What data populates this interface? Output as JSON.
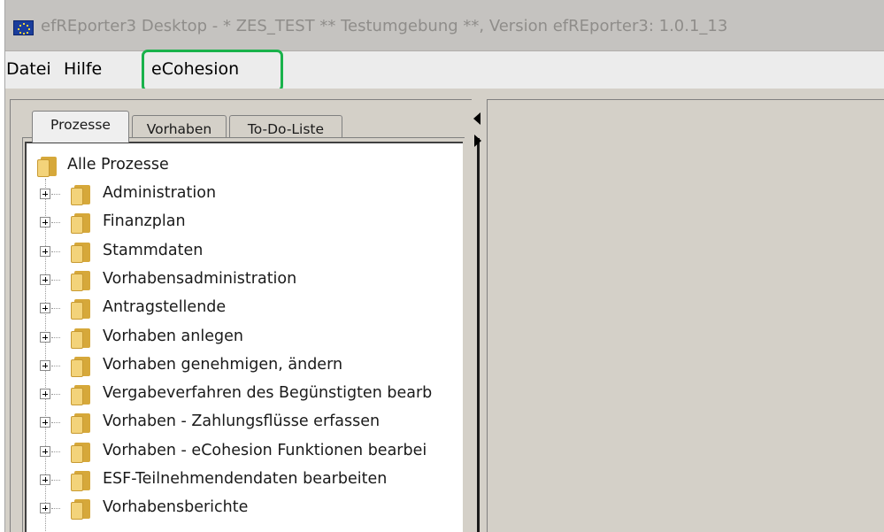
{
  "window": {
    "title": "efREporter3 Desktop - * ZES_TEST  ** Testumgebung **, Version efREporter3: 1.0.1_13",
    "icon": "eu-flag-icon"
  },
  "menu": {
    "items": [
      {
        "label": "Datei"
      },
      {
        "label": "Hilfe"
      },
      {
        "label": "eCohesion"
      }
    ],
    "highlighted": "eCohesion",
    "highlight_color": "#19b24b"
  },
  "tabs": [
    {
      "label": "Prozesse",
      "active": true
    },
    {
      "label": "Vorhaben",
      "active": false
    },
    {
      "label": "To-Do-Liste",
      "active": false
    }
  ],
  "tree": {
    "root": {
      "label": "Alle Prozesse",
      "icon": "folder-icon"
    },
    "items": [
      {
        "label": "Administration"
      },
      {
        "label": "Finanzplan"
      },
      {
        "label": "Stammdaten"
      },
      {
        "label": "Vorhabensadministration"
      },
      {
        "label": "Antragstellende"
      },
      {
        "label": "Vorhaben anlegen"
      },
      {
        "label": "Vorhaben genehmigen, ändern"
      },
      {
        "label": "Vergabeverfahren des Begünstigten bearb"
      },
      {
        "label": "Vorhaben - Zahlungsflüsse erfassen"
      },
      {
        "label": "Vorhaben - eCohesion Funktionen bearbei"
      },
      {
        "label": "ESF-Teilnehmendendaten bearbeiten"
      },
      {
        "label": "Vorhabensberichte"
      }
    ]
  }
}
